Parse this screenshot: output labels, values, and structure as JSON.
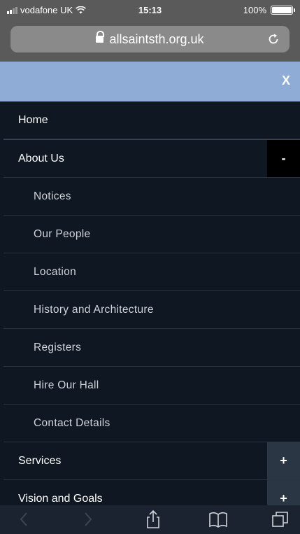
{
  "status_bar": {
    "carrier": "vodafone UK",
    "time": "15:13",
    "battery": "100%",
    "battery_level": 1.0
  },
  "browser": {
    "url": "allsaintsth.org.uk"
  },
  "menu": {
    "close_label": "X",
    "items": [
      {
        "label": "Home"
      },
      {
        "label": "About Us",
        "toggle": "-"
      },
      {
        "label": "Notices"
      },
      {
        "label": "Our People"
      },
      {
        "label": "Location"
      },
      {
        "label": "History and Architecture"
      },
      {
        "label": "Registers"
      },
      {
        "label": "Hire Our Hall"
      },
      {
        "label": "Contact Details"
      },
      {
        "label": "Services",
        "toggle": "+"
      },
      {
        "label": "Vision and Goals",
        "toggle": "+"
      }
    ]
  },
  "icons": {
    "back": "chevron-left-icon",
    "forward": "chevron-right-icon",
    "share": "share-icon",
    "bookmarks": "book-icon",
    "tabs": "tabs-icon"
  }
}
